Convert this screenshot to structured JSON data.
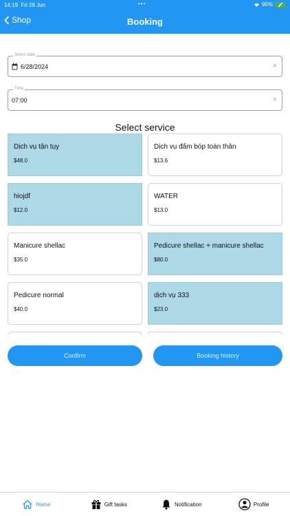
{
  "status_bar": {
    "time": "14:19",
    "date": "Fri 28 Jun",
    "battery": "95%"
  },
  "nav": {
    "back_label": "Shop",
    "title": "Booking"
  },
  "date_field": {
    "label": "Select date",
    "value": "6/28/2024"
  },
  "time_field": {
    "label": "Time",
    "value": "07:00"
  },
  "clear_glyph": "×",
  "section_title": "Select service",
  "services": [
    {
      "name": "Dịch vụ tận tụy",
      "price": "$48.0",
      "selected": true
    },
    {
      "name": "Dịch vụ đấm bóp toàn thân",
      "price": "$13.6",
      "selected": false
    },
    {
      "name": "hiojdf",
      "price": "$12.0",
      "selected": true
    },
    {
      "name": "WATER",
      "price": "$13.0",
      "selected": false
    },
    {
      "name": "Manicure shellac",
      "price": "$35.0",
      "selected": false
    },
    {
      "name": "Pedicure shellac + manicure shellac",
      "price": "$80.0",
      "selected": true
    },
    {
      "name": "Pedicure normal",
      "price": "$40.0",
      "selected": false
    },
    {
      "name": "dịch vụ 333",
      "price": "$23.0",
      "selected": true
    },
    {
      "name": "",
      "price": "",
      "selected": false
    },
    {
      "name": "",
      "price": "",
      "selected": false
    }
  ],
  "buttons": {
    "confirm": "Confirm",
    "history": "Booking history"
  },
  "tabs": [
    {
      "label": "Home",
      "icon": "home-icon",
      "active": true
    },
    {
      "label": "Gift tasks",
      "icon": "gift-icon",
      "active": false
    },
    {
      "label": "Notification",
      "icon": "bell-icon",
      "active": false
    },
    {
      "label": "Profile",
      "icon": "profile-icon",
      "active": false
    }
  ],
  "colors": {
    "primary": "#2196f3",
    "selected_card": "#add8e6",
    "battery": "#4caf50"
  }
}
